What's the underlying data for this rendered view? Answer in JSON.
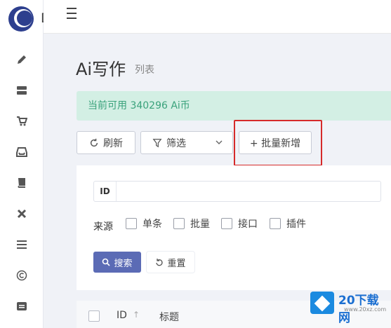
{
  "brand": {
    "letter": "D"
  },
  "page": {
    "title": "Ai写作",
    "subtitle": "列表"
  },
  "alert": {
    "text": "当前可用 340296 Ai币"
  },
  "toolbar": {
    "refresh_label": "刷新",
    "filter_label": "筛选",
    "add_label": "+ 批量新增"
  },
  "filters": {
    "id_label": "ID",
    "id_placeholder": "",
    "source_label": "来源",
    "source_options": [
      "单条",
      "批量",
      "接口",
      "插件"
    ],
    "search_label": "搜索",
    "reset_label": "重置"
  },
  "table": {
    "columns": [
      "ID",
      "标题"
    ],
    "sort_glyph": "↑"
  },
  "sidebar": {
    "icons": [
      "pencil-icon",
      "server-icon",
      "cart-icon",
      "inbox-icon",
      "book-icon",
      "joomla-icon",
      "list-icon",
      "copyright-icon",
      "message-icon"
    ]
  },
  "watermark": {
    "text": "20下载网",
    "sub": "www.20xz.com"
  },
  "colors": {
    "accent": "#5b6bb5",
    "alert_bg": "#d3efe4",
    "alert_text": "#3aa27b",
    "highlight": "#d62a2a",
    "logo": "#2d3f8e"
  }
}
